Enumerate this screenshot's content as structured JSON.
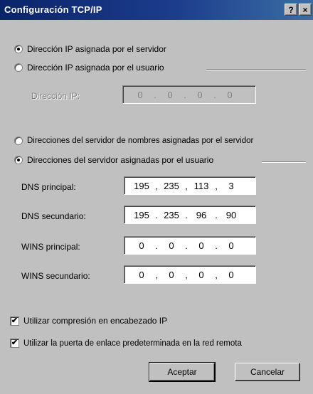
{
  "window": {
    "title": "Configuración TCP/IP",
    "help_glyph": "?",
    "close_glyph": "×"
  },
  "ip_section": {
    "option_server": "Dirección IP asignada por el servidor",
    "option_user": "Dirección IP asignada por el usuario",
    "selected": "server",
    "ip_label": "Dirección IP:",
    "ip_value": [
      "0",
      "0",
      "0",
      "0"
    ]
  },
  "dns_section": {
    "option_server": "Direcciones del servidor de nombres asignadas por el servidor",
    "option_user": "Direcciones del servidor asignadas por el usuario",
    "selected": "user",
    "fields": [
      {
        "label": "DNS principal:",
        "octets": [
          "195",
          "235",
          "113",
          "3"
        ]
      },
      {
        "label": "DNS secundario:",
        "octets": [
          "195",
          "235",
          "96",
          "90"
        ]
      },
      {
        "label": "WINS principal:",
        "octets": [
          "0",
          "0",
          "0",
          "0"
        ]
      },
      {
        "label": "WINS secundario:",
        "octets": [
          "0",
          "0",
          "0",
          "0"
        ]
      }
    ]
  },
  "options": {
    "compression_label": "Utilizar compresión en encabezado IP",
    "compression_checked": true,
    "gateway_label": "Utilizar la puerta de enlace predeterminada en la red remota",
    "gateway_checked": true,
    "check_glyph": "✔"
  },
  "buttons": {
    "ok": "Aceptar",
    "cancel": "Cancelar"
  }
}
